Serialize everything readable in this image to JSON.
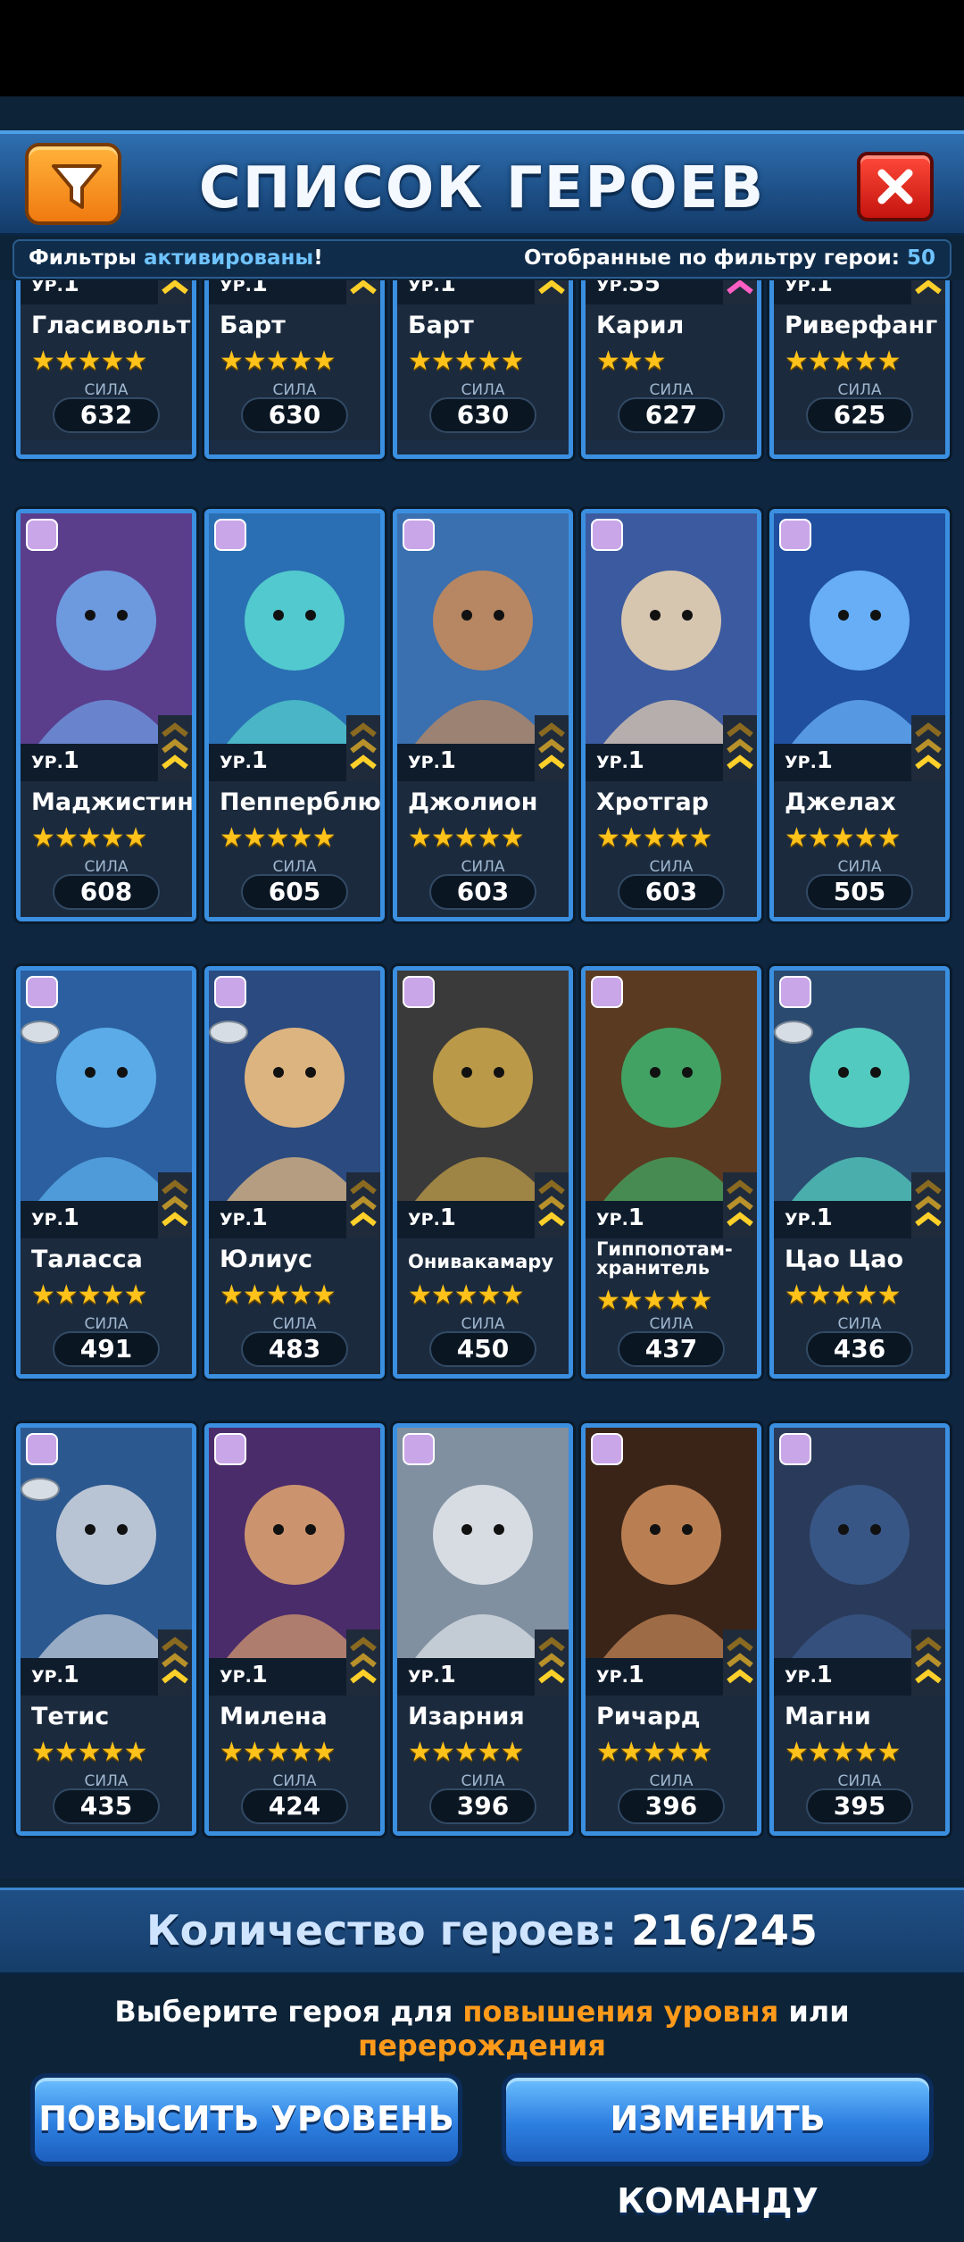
{
  "header": {
    "title": "СПИСОК ГЕРОЕВ"
  },
  "filter_status": {
    "prefix": "Фильтры",
    "active": "активированы",
    "suffix": "!",
    "count_label": "Отобранные по фильтру герои:",
    "count": "50"
  },
  "labels": {
    "level": "УР.",
    "power": "СИЛА"
  },
  "heroes": [
    {
      "name": "Гласивольт",
      "level": "1",
      "stars": 5,
      "power": "632"
    },
    {
      "name": "Барт",
      "level": "1",
      "stars": 5,
      "power": "630"
    },
    {
      "name": "Барт",
      "level": "1",
      "stars": 5,
      "power": "630"
    },
    {
      "name": "Карил",
      "level": "55",
      "stars": 3,
      "power": "627"
    },
    {
      "name": "Риверфанг",
      "level": "1",
      "stars": 5,
      "power": "625"
    },
    {
      "name": "Маджистин",
      "level": "1",
      "stars": 5,
      "power": "608"
    },
    {
      "name": "Пепперблю",
      "level": "1",
      "stars": 5,
      "power": "605"
    },
    {
      "name": "Джолион",
      "level": "1",
      "stars": 5,
      "power": "603"
    },
    {
      "name": "Хротгар",
      "level": "1",
      "stars": 5,
      "power": "603"
    },
    {
      "name": "Джелах",
      "level": "1",
      "stars": 5,
      "power": "505"
    },
    {
      "name": "Таласса",
      "level": "1",
      "stars": 5,
      "power": "491"
    },
    {
      "name": "Юлиус",
      "level": "1",
      "stars": 5,
      "power": "483"
    },
    {
      "name": "Онивакамару",
      "level": "1",
      "stars": 5,
      "power": "450"
    },
    {
      "name": "Гиппопотам-хранитель",
      "level": "1",
      "stars": 5,
      "power": "437"
    },
    {
      "name": "Цао Цао",
      "level": "1",
      "stars": 5,
      "power": "436"
    },
    {
      "name": "Тетис",
      "level": "1",
      "stars": 5,
      "power": "435"
    },
    {
      "name": "Милена",
      "level": "1",
      "stars": 5,
      "power": "424"
    },
    {
      "name": "Изарния",
      "level": "1",
      "stars": 5,
      "power": "396"
    },
    {
      "name": "Ричард",
      "level": "1",
      "stars": 5,
      "power": "396"
    },
    {
      "name": "Магни",
      "level": "1",
      "stars": 5,
      "power": "395"
    }
  ],
  "footer": {
    "count_label": "Количество героев:",
    "count_value": "216/245",
    "instruction_1": "Выберите героя для ",
    "instruction_hl1": "повышения уровня",
    "instruction_2": " или ",
    "instruction_hl2": "перерождения",
    "level_up_button": "ПОВЫСИТЬ УРОВЕНЬ",
    "change_team_button": "ИЗМЕНИТЬ КОМАНДУ"
  },
  "colors": {
    "accent": "#3b8fe0",
    "highlight": "#ff9a1a",
    "star": "#ffc21a"
  }
}
